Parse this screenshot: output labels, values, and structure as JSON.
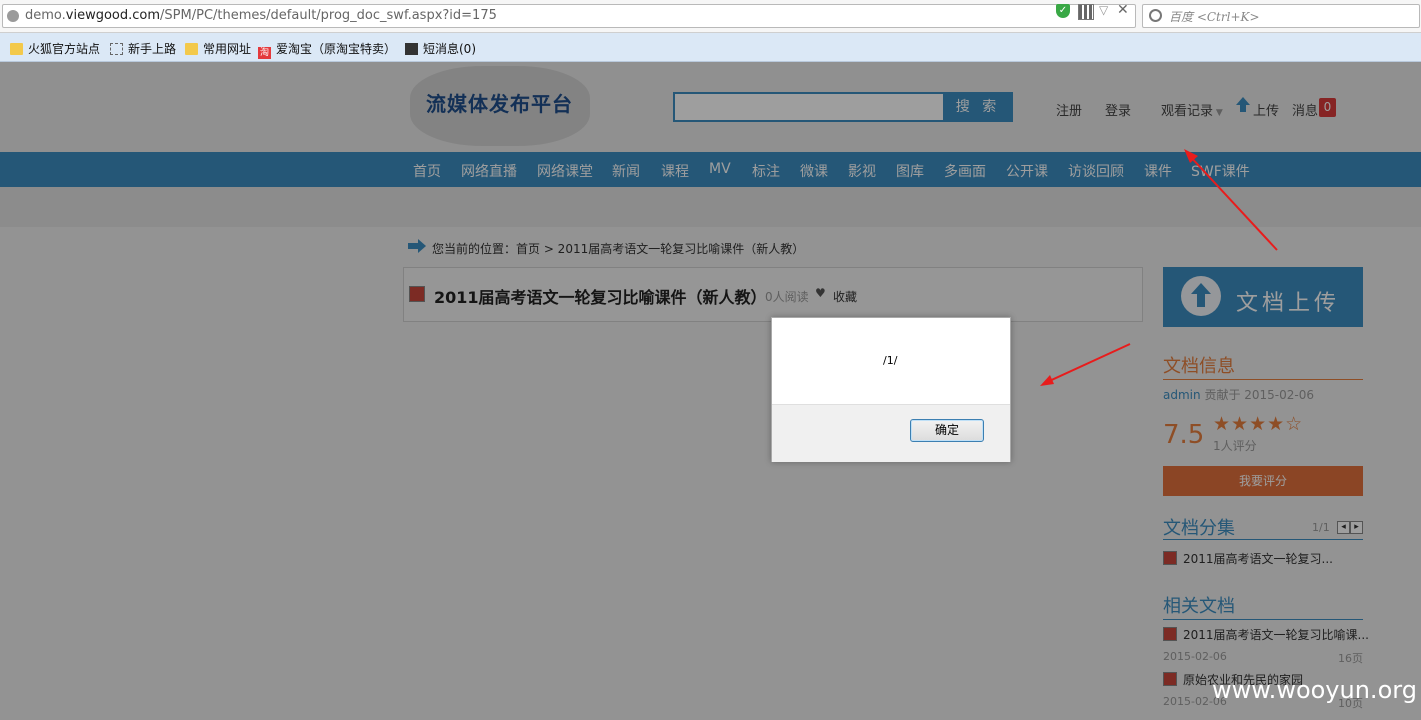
{
  "browser": {
    "url_prefix": "demo.",
    "url_host": "viewgood.com",
    "url_path": "/SPM/PC/themes/default/prog_doc_swf.aspx?id=175",
    "search_placeholder": "百度 <Ctrl+K>",
    "bookmarks": [
      {
        "label": "火狐官方站点",
        "icon": "folder-icon"
      },
      {
        "label": "新手上路",
        "icon": "page-icon"
      },
      {
        "label": "常用网址",
        "icon": "folder-icon"
      },
      {
        "label": "爱淘宝（原淘宝特卖）",
        "icon": "taobao-icon",
        "icon_text": "淘"
      },
      {
        "label": "短消息(0)",
        "icon": "message-icon"
      }
    ]
  },
  "site": {
    "logo": "流媒体发布平台",
    "search_button": "搜 索",
    "register": "注册",
    "login": "登录",
    "history": "观看记录",
    "upload": "上传",
    "messages": "消息",
    "message_count": "0",
    "nav": [
      "首页",
      "网络直播",
      "网络课堂",
      "新闻",
      "课程",
      "MV",
      "标注",
      "微课",
      "影视",
      "图库",
      "多画面",
      "公开课",
      "访谈回顾",
      "课件",
      "SWF课件"
    ]
  },
  "breadcrumb": "您当前的位置：首页 > 2011届高考语文一轮复习比喻课件（新人教）",
  "document": {
    "title": "2011届高考语文一轮复习比喻课件（新人教）",
    "read_count": "0人阅读",
    "favorite": "收藏"
  },
  "sidebar": {
    "upload_button": "文档上传",
    "info_heading": "文档信息",
    "author": "admin",
    "contributed": "贡献于 2015-02-06",
    "score": "7.5",
    "stars": "★★★★☆",
    "star_rating": 3.5,
    "raters": "1人评分",
    "rate_button": "我要评分",
    "share_heading": "文档分集",
    "share_pager": "1/1",
    "share_items": [
      "2011届高考语文一轮复习..."
    ],
    "related_heading": "相关文档",
    "related": [
      {
        "title": "2011届高考语文一轮复习比喻课...",
        "date": "2015-02-06",
        "pages": "16页"
      },
      {
        "title": "原始农业和先民的家园",
        "date": "2015-02-06",
        "pages": "10页"
      }
    ]
  },
  "dialog": {
    "message": "/1/",
    "ok_button": "确定"
  },
  "watermark": "www.wooyun.org",
  "colors": {
    "accent": "#3c8dc0",
    "orange": "#e67e3e",
    "annotation": "#e81c1c"
  }
}
